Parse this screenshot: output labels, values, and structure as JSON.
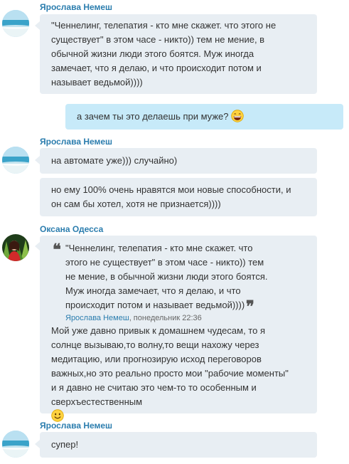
{
  "chat": {
    "messages": [
      {
        "sender": "Ярослава Немеш",
        "bubbles": [
          "\"Ченнелинг, телепатия - кто мне скажет. что этого не\nсуществует\"  в этом часе - никто)) тем не мение, в\nобычной жизни люди этого боятся. Муж иногда\nзамечает, что я делаю, и что происходит потом и\nназывает ведьмой))))"
        ]
      },
      {
        "outgoing": true,
        "bubbles": [
          "а зачем ты это делаешь при муже?"
        ]
      },
      {
        "sender": "Ярослава Немеш",
        "bubbles": [
          "на автомате уже))) случайно)",
          "но ему 100% очень нравятся мои новые способности, и\nон сам бы хотел, хотя не признается))))"
        ]
      },
      {
        "sender": "Оксана Одесса",
        "quote": {
          "text": "\"Ченнелинг, телепатия - кто мне скажет. что\nэтого не существует\"  в этом часе - никто)) тем\nне мение, в обычной жизни люди этого боятся.\nМуж иногда замечает, что я делаю, и что\nпроисходит потом и называет ведьмой))))",
          "author": "Ярослава Немеш",
          "when": ", понедельник 22:36"
        },
        "reply": "Мой уже давно привык к домашнем чудесам, то я\nсолнце вызываю,то волну,то вещи нахожу через\nмедитацию, или прогнозирую исход переговоров\nважных,но это реально просто мои \"рабочие моменты\"\nи я давно не считаю это чем-то то особенным и\nсверхъестественным"
      },
      {
        "sender": "Ярослава Немеш",
        "bubbles": [
          "супер!"
        ]
      }
    ]
  },
  "icons": {
    "emoji_laugh": "laughing-emoji",
    "emoji_smile": "smiling-emoji"
  },
  "colors": {
    "sender_name": "#2b7dae",
    "incoming_bubble": "#e8eef3",
    "outgoing_bubble": "#c7eaf9"
  }
}
